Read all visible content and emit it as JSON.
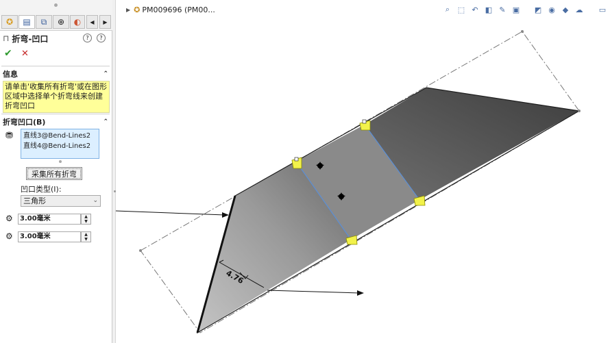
{
  "panel": {
    "tabs": [
      {
        "icon": "feature-manager-icon"
      },
      {
        "icon": "property-manager-icon"
      },
      {
        "icon": "configuration-manager-icon"
      },
      {
        "icon": "dimxpert-icon"
      },
      {
        "icon": "display-manager-icon"
      }
    ],
    "title": "折弯-凹口",
    "help_labels": [
      "?",
      "?"
    ],
    "confirm_symbol": "✔",
    "cancel_symbol": "✕",
    "info": {
      "header": "信息",
      "text": "请单击'收集所有折弯'或在图形区域中选择单个折弯线来创建折弯凹口"
    },
    "relief": {
      "header": "折弯凹口(B)",
      "items": [
        "直线3@Bend-Lines2",
        "直线4@Bend-Lines2"
      ],
      "collect_button": "采集所有折弯",
      "type_label": "凹口类型(I):",
      "type_value": "三角形",
      "param1": "3.00毫米",
      "param2": "3.00毫米"
    }
  },
  "viewport": {
    "breadcrumb": "PM009696 (PM00...",
    "dimension_label": "4.76"
  },
  "colors": {
    "info_bg": "#ffff99",
    "selection_bg": "#dcefff",
    "bend_line": "#5b8fd6",
    "handle": "#e6e600"
  }
}
